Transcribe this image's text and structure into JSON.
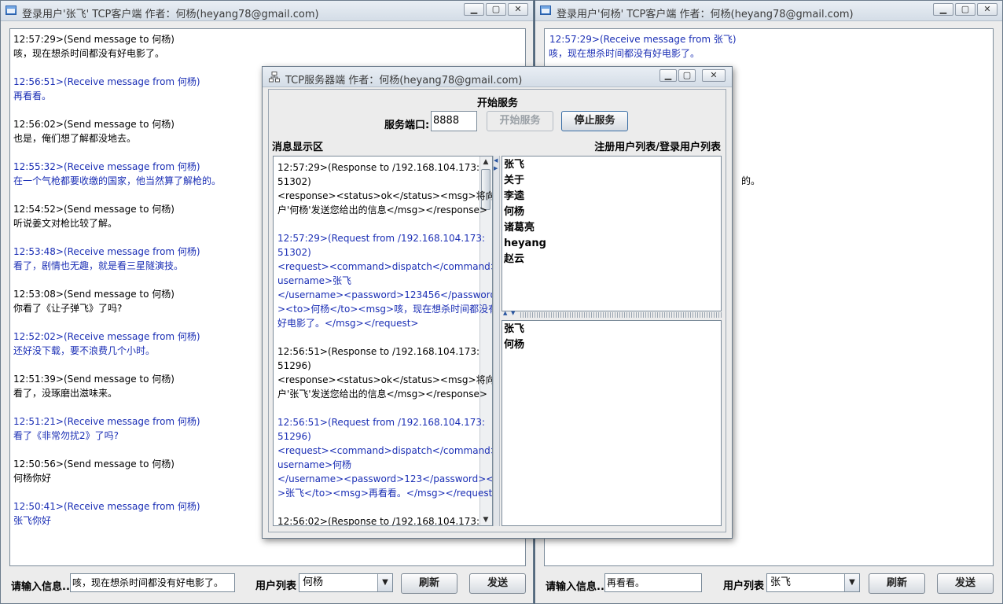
{
  "left_client": {
    "title": "登录用户'张飞' TCP客户端 作者：何杨(heyang78@gmail.com)",
    "window_buttons": [
      "▁",
      "▢",
      "✕"
    ],
    "messages": [
      {
        "head": "12:57:29>(Send message to 何杨)",
        "body": "咳，现在想杀时间都没有好电影了。",
        "dir": "send"
      },
      {
        "head": "12:56:51>(Receive message from 何杨)",
        "body": "再看看。",
        "dir": "recv"
      },
      {
        "head": "12:56:02>(Send message to 何杨)",
        "body": "也是，俺们想了解都没地去。",
        "dir": "send"
      },
      {
        "head": "12:55:32>(Receive message from 何杨)",
        "body": "在一个气枪都要收缴的国家，他当然算了解枪的。",
        "dir": "recv"
      },
      {
        "head": "12:54:52>(Send message to 何杨)",
        "body": "听说姜文对枪比较了解。",
        "dir": "send"
      },
      {
        "head": "12:53:48>(Receive message from 何杨)",
        "body": "看了，剧情也无趣，就是看三星隧演技。",
        "dir": "recv"
      },
      {
        "head": "12:53:08>(Send message to 何杨)",
        "body": "你看了《让子弹飞》了吗?",
        "dir": "send"
      },
      {
        "head": "12:52:02>(Receive message from 何杨)",
        "body": "还好没下载，要不浪费几个小时。",
        "dir": "recv"
      },
      {
        "head": "12:51:39>(Send message to 何杨)",
        "body": "看了，没琢磨出滋味来。",
        "dir": "send"
      },
      {
        "head": "12:51:21>(Receive message from 何杨)",
        "body": "看了《非常勿扰2》了吗?",
        "dir": "recv"
      },
      {
        "head": "12:50:56>(Send message to 何杨)",
        "body": "何杨你好",
        "dir": "send"
      },
      {
        "head": "12:50:41>(Receive message from 何杨)",
        "body": "张飞你好",
        "dir": "recv"
      }
    ],
    "input_label": "请输入信息...",
    "input_value": "咳，现在想杀时间都没有好电影了。",
    "user_list_label": "用户列表",
    "selected_user": "何杨",
    "refresh_label": "刷新",
    "send_label": "发送"
  },
  "right_client": {
    "title": "登录用户'何杨' TCP客户端 作者：何杨(heyang78@gmail.com)",
    "window_buttons": [
      "▁",
      "▢",
      "✕"
    ],
    "visible_messages": [
      {
        "text": "12:57:29>(Receive message from 张飞)",
        "dir": "recv"
      },
      {
        "text": "咳，现在想杀时间都没有好电影了。",
        "dir": "recv"
      }
    ],
    "partial_text": "的。",
    "input_label": "请输入信息...",
    "input_value": "再看看。",
    "user_list_label": "用户列表",
    "selected_user": "张飞",
    "refresh_label": "刷新",
    "send_label": "发送"
  },
  "server": {
    "title": "TCP服务器端 作者：何杨(heyang78@gmail.com)",
    "window_buttons": [
      "▁",
      "▢",
      "✕"
    ],
    "header": "开始服务",
    "port_label": "服务端口:",
    "port_value": "8888",
    "start_button": "开始服务",
    "stop_button": "停止服务",
    "log_label": "消息显示区",
    "users_label": "注册用户列表/登录用户列表",
    "log_lines": [
      {
        "t": "12:57:29>(Response to /192.168.104.173:",
        "c": "black"
      },
      {
        "t": "51302)",
        "c": "black"
      },
      {
        "t": "<response><status>ok</status><msg>将向用",
        "c": "black"
      },
      {
        "t": "户'何杨'发送您给出的信息</msg></response>",
        "c": "black"
      },
      {
        "t": "",
        "c": "black"
      },
      {
        "t": "12:57:29>(Request from /192.168.104.173:",
        "c": "blue"
      },
      {
        "t": "51302)",
        "c": "blue"
      },
      {
        "t": "<request><command>dispatch</command><",
        "c": "blue"
      },
      {
        "t": "username>张飞",
        "c": "blue"
      },
      {
        "t": "</username><password>123456</password",
        "c": "blue"
      },
      {
        "t": "><to>何杨</to><msg>咳，现在想杀时间都没有",
        "c": "blue"
      },
      {
        "t": "好电影了。</msg></request>",
        "c": "blue"
      },
      {
        "t": "",
        "c": "black"
      },
      {
        "t": "12:56:51>(Response to /192.168.104.173:",
        "c": "black"
      },
      {
        "t": "51296)",
        "c": "black"
      },
      {
        "t": "<response><status>ok</status><msg>将向用",
        "c": "black"
      },
      {
        "t": "户'张飞'发送您给出的信息</msg></response>",
        "c": "black"
      },
      {
        "t": "",
        "c": "black"
      },
      {
        "t": "12:56:51>(Request from /192.168.104.173:",
        "c": "blue"
      },
      {
        "t": "51296)",
        "c": "blue"
      },
      {
        "t": "<request><command>dispatch</command><",
        "c": "blue"
      },
      {
        "t": "username>何杨",
        "c": "blue"
      },
      {
        "t": "</username><password>123</password><to",
        "c": "blue"
      },
      {
        "t": ">张飞</to><msg>再看看。</msg></request>",
        "c": "blue"
      },
      {
        "t": "",
        "c": "black"
      },
      {
        "t": "12:56:02>(Response to /192.168.104.173:",
        "c": "black"
      }
    ],
    "registered_users": [
      "张飞",
      "关于",
      "李逵",
      "何杨",
      "诸葛亮",
      "heyang",
      "赵云"
    ],
    "logged_in_users": [
      "张飞",
      "何杨"
    ]
  },
  "colors": {
    "receive_text": "#1b2fb5",
    "desktop": "#3d5a73"
  }
}
